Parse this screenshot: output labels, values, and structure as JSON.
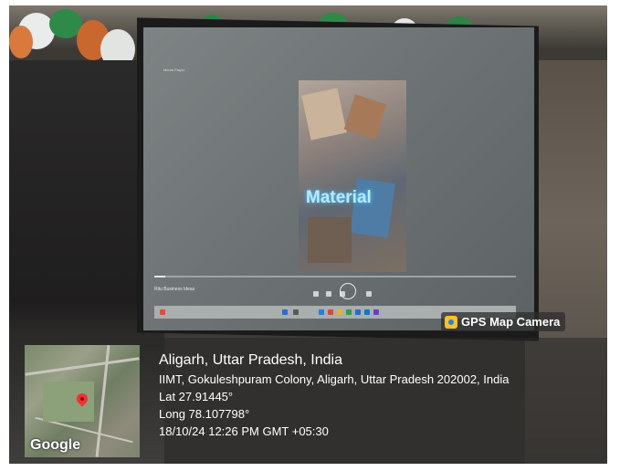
{
  "video_overlay_text": "Material",
  "player": {
    "window_title": "Media Player",
    "track_title": "Ritu Business Ideas"
  },
  "gps_badge": {
    "label": "GPS Map Camera"
  },
  "location": {
    "place": "Aligarh, Uttar Pradesh, India",
    "address": "IIMT, Gokuleshpuram Colony, Aligarh, Uttar Pradesh 202002, India",
    "lat": "Lat 27.91445°",
    "long": "Long 78.107798°",
    "datetime": "18/10/24 12:26 PM GMT +05:30"
  },
  "map": {
    "logo_text": "Google",
    "pin_color": "#e33333"
  },
  "colors": {
    "screen": "#6c7273",
    "badge_bg": "#2d2d2d",
    "overlay_text": "#ffffff"
  }
}
